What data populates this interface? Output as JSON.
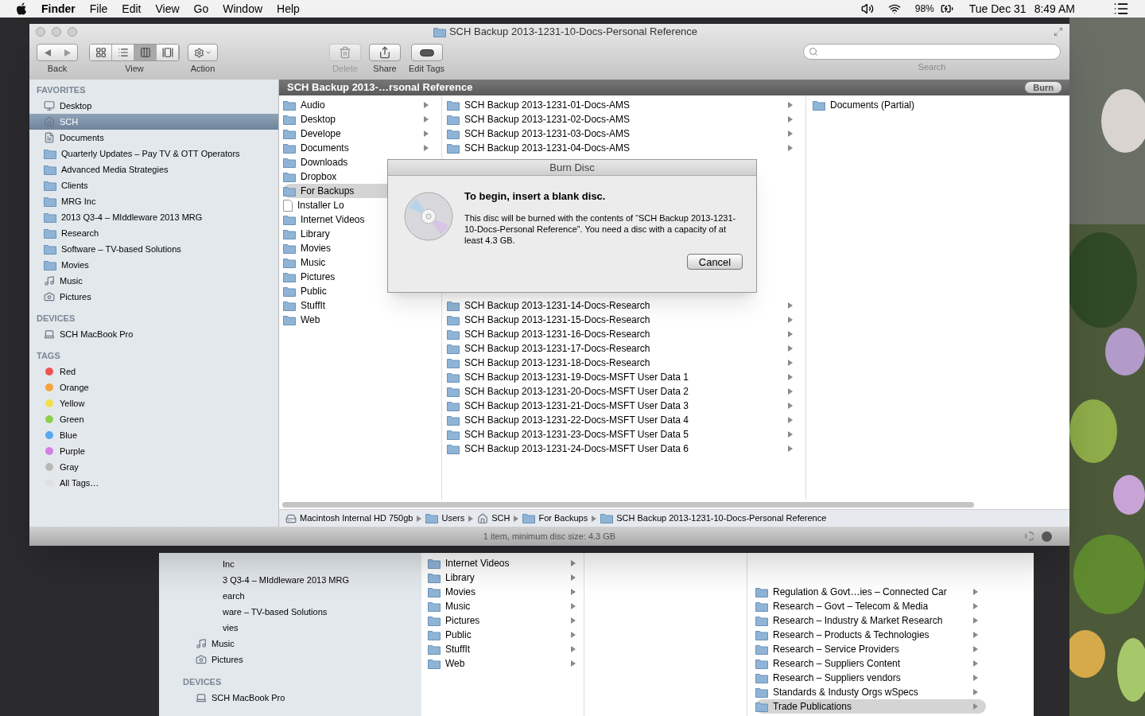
{
  "menu_bar": {
    "app": "Finder",
    "menus": [
      "File",
      "Edit",
      "View",
      "Go",
      "Window",
      "Help"
    ],
    "battery": "98%",
    "date": "Tue Dec 31",
    "time": "8:49 AM"
  },
  "window": {
    "title": "SCH Backup 2013-1231-10-Docs-Personal Reference",
    "toolbar": {
      "back_label": "Back",
      "view_label": "View",
      "view_modes": [
        {
          "kind": "icons",
          "selected": false
        },
        {
          "kind": "list",
          "selected": false
        },
        {
          "kind": "columns",
          "selected": true
        },
        {
          "kind": "coverflow",
          "selected": false
        }
      ],
      "action_label": "Action",
      "buttons": [
        {
          "kind": "trash",
          "label": "Delete",
          "disabled": true
        },
        {
          "kind": "share",
          "label": "Share",
          "disabled": false
        },
        {
          "kind": "tag",
          "label": "Edit Tags",
          "disabled": false
        }
      ],
      "search_label": "Search"
    },
    "sidebar": [
      {
        "heading": "FAVORITES",
        "items": [
          {
            "label": "Desktop",
            "kind": "desktop",
            "selected": false
          },
          {
            "label": "SCH",
            "kind": "home",
            "selected": true
          },
          {
            "label": "Documents",
            "kind": "doc",
            "selected": false
          },
          {
            "label": "Quarterly Updates – Pay TV & OTT Operators",
            "kind": "folder",
            "selected": false
          },
          {
            "label": "Advanced Media Strategies",
            "kind": "folder",
            "selected": false
          },
          {
            "label": "Clients",
            "kind": "folder",
            "selected": false
          },
          {
            "label": "MRG Inc",
            "kind": "folder",
            "selected": false
          },
          {
            "label": "2013 Q3-4 – MIddleware 2013 MRG",
            "kind": "folder",
            "selected": false
          },
          {
            "label": "Research",
            "kind": "folder",
            "selected": false
          },
          {
            "label": "Software – TV-based Solutions",
            "kind": "folder",
            "selected": false
          },
          {
            "label": "Movies",
            "kind": "folder",
            "selected": false
          },
          {
            "label": "Music",
            "kind": "music",
            "selected": false
          },
          {
            "label": "Pictures",
            "kind": "camera",
            "selected": false
          }
        ]
      },
      {
        "heading": "DEVICES",
        "items": [
          {
            "label": "SCH MacBook Pro",
            "kind": "laptop",
            "selected": false
          }
        ]
      },
      {
        "heading": "TAGS",
        "items": [
          {
            "label": "Red",
            "kind": "tag",
            "color": "#f0524f",
            "selected": false
          },
          {
            "label": "Orange",
            "kind": "tag",
            "color": "#f5a33b",
            "selected": false
          },
          {
            "label": "Yellow",
            "kind": "tag",
            "color": "#f4e04d",
            "selected": false
          },
          {
            "label": "Green",
            "kind": "tag",
            "color": "#8ccf4d",
            "selected": false
          },
          {
            "label": "Blue",
            "kind": "tag",
            "color": "#55a8f0",
            "selected": false
          },
          {
            "label": "Purple",
            "kind": "tag",
            "color": "#d57fe3",
            "selected": false
          },
          {
            "label": "Gray",
            "kind": "tag",
            "color": "#b8b8b8",
            "selected": false
          },
          {
            "label": "All Tags…",
            "kind": "tag",
            "color": "#e0e0e0",
            "selected": false
          }
        ]
      }
    ],
    "column_header": {
      "title": "SCH Backup 2013-…rsonal Reference",
      "button": "Burn"
    },
    "column_1": [
      {
        "label": "Audio",
        "kind": "folder",
        "selected": false,
        "arrow": true
      },
      {
        "label": "Desktop",
        "kind": "folder",
        "selected": false,
        "arrow": true
      },
      {
        "label": "Develope",
        "kind": "folder",
        "selected": false,
        "arrow": true
      },
      {
        "label": "Documents",
        "kind": "folder",
        "selected": false,
        "arrow": true
      },
      {
        "label": "Downloads",
        "kind": "folder",
        "selected": false
      },
      {
        "label": "Dropbox",
        "kind": "folder",
        "selected": false
      },
      {
        "label": "For Backups",
        "kind": "folder",
        "selected": true
      },
      {
        "label": "Installer Lo",
        "kind": "file",
        "selected": false
      },
      {
        "label": "Internet Videos",
        "kind": "folder",
        "selected": false
      },
      {
        "label": "Library",
        "kind": "folder",
        "selected": false
      },
      {
        "label": "Movies",
        "kind": "folder",
        "selected": false
      },
      {
        "label": "Music",
        "kind": "folder",
        "selected": false
      },
      {
        "label": "Pictures",
        "kind": "folder",
        "selected": false
      },
      {
        "label": "Public",
        "kind": "folder",
        "selected": false,
        "arrow": false
      },
      {
        "label": "StuffIt",
        "kind": "folder",
        "selected": false,
        "arrow": false
      },
      {
        "label": "Web",
        "kind": "folder",
        "selected": false,
        "arrow": false
      }
    ],
    "column_2_top": [
      "SCH Backup 2013-1231-01-Docs-AMS",
      "SCH Backup 2013-1231-02-Docs-AMS",
      "SCH Backup 2013-1231-03-Docs-AMS",
      "SCH Backup 2013-1231-04-Docs-AMS"
    ],
    "column_2_bottom": [
      "SCH Backup 2013-1231-14-Docs-Research",
      "SCH Backup 2013-1231-15-Docs-Research",
      "SCH Backup 2013-1231-16-Docs-Research",
      "SCH Backup 2013-1231-17-Docs-Research",
      "SCH Backup 2013-1231-18-Docs-Research",
      "SCH Backup 2013-1231-19-Docs-MSFT User Data 1",
      "SCH Backup 2013-1231-20-Docs-MSFT User Data 2",
      "SCH Backup 2013-1231-21-Docs-MSFT User Data 3",
      "SCH Backup 2013-1231-22-Docs-MSFT User Data 4",
      "SCH Backup 2013-1231-23-Docs-MSFT User Data 5",
      "SCH Backup 2013-1231-24-Docs-MSFT User Data 6"
    ],
    "column_3": [
      "Documents (Partial)"
    ],
    "path_bar": [
      {
        "label": "Macintosh Internal HD 750gb",
        "kind": "disk"
      },
      {
        "label": "Users",
        "kind": "folder"
      },
      {
        "label": "SCH",
        "kind": "home"
      },
      {
        "label": "For Backups",
        "kind": "folder"
      },
      {
        "label": "SCH Backup 2013-1231-10-Docs-Personal Reference",
        "kind": "folder"
      }
    ],
    "status": "1 item, minimum disc size: 4.3 GB"
  },
  "dialog": {
    "title": "Burn Disc",
    "heading": "To begin, insert a blank disc.",
    "message": "This disc will be burned with the contents of “SCH Backup 2013-1231-10-Docs-Personal Reference”. You need a disc with a capacity of at least 4.3 GB.",
    "button": "Cancel"
  },
  "lower_window": {
    "sidebar_fragments": [
      "Inc",
      "3 Q3-4 – MIddleware 2013 MRG",
      "earch",
      "ware – TV-based Solutions",
      "vies"
    ],
    "sidebar_items": [
      {
        "label": "Music",
        "kind": "music"
      },
      {
        "label": "Pictures",
        "kind": "camera"
      }
    ],
    "devices_heading": "DEVICES",
    "device": "SCH MacBook Pro",
    "column_a": [
      "Internet Videos",
      "Library",
      "Movies",
      "Music",
      "Pictures",
      "Public",
      "StuffIt",
      "Web"
    ],
    "column_b": [
      {
        "label": "Regulation & Govt…ies – Connected Car",
        "selected": false
      },
      {
        "label": "Research – Govt – Telecom & Media",
        "selected": false
      },
      {
        "label": "Research – Industry & Market Research",
        "selected": false
      },
      {
        "label": "Research – Products & Technologies",
        "selected": false
      },
      {
        "label": "Research – Service Providers",
        "selected": false
      },
      {
        "label": "Research – Suppliers Content",
        "selected": false
      },
      {
        "label": "Research – Suppliers vendors",
        "selected": false
      },
      {
        "label": "Standards & Industy Orgs wSpecs",
        "selected": false
      },
      {
        "label": "Trade Publications",
        "selected": true
      }
    ]
  }
}
